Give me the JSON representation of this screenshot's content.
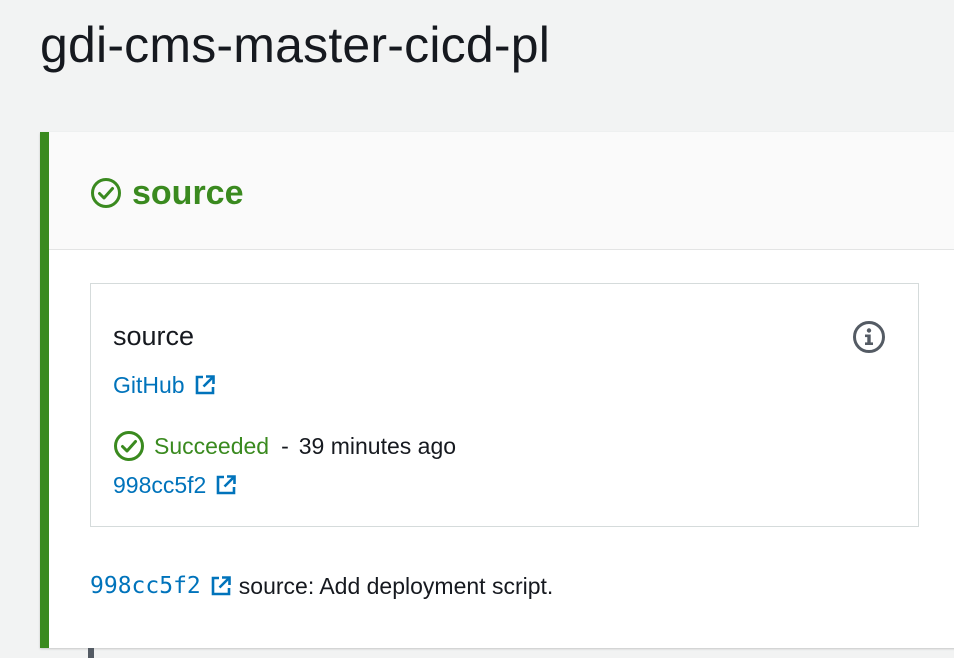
{
  "pipeline": {
    "title": "gdi-cms-master-cicd-pl"
  },
  "stage": {
    "name": "source",
    "status": "succeeded",
    "status_icon": "check-circle-icon",
    "accent_color": "#3a8a1f"
  },
  "action": {
    "name": "source",
    "provider_label": "GitHub",
    "provider_icon": "external-link-icon",
    "info_icon": "info-icon",
    "status_label": "Succeeded",
    "status_separator": "-",
    "status_time": "39 minutes ago",
    "commit_id": "998cc5f2",
    "link_color": "#0073bb"
  },
  "commit_summary": {
    "commit_id": "998cc5f2",
    "message": "source: Add deployment script."
  }
}
